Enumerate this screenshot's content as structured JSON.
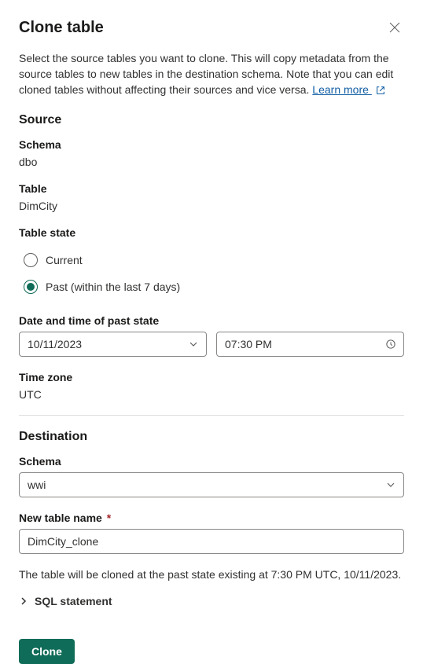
{
  "header": {
    "title": "Clone table"
  },
  "description": {
    "text": "Select the source tables you want to clone. This will copy metadata from the source tables to new tables in the destination schema. Note that you can edit cloned tables without affecting their sources and vice versa. ",
    "learn_more": "Learn more "
  },
  "source": {
    "heading": "Source",
    "schema_label": "Schema",
    "schema_value": "dbo",
    "table_label": "Table",
    "table_value": "DimCity",
    "state_label": "Table state",
    "radios": {
      "current": "Current",
      "past": "Past (within the last 7 days)"
    },
    "datetime_label": "Date and time of past state",
    "date_value": "10/11/2023",
    "time_value": "07:30 PM",
    "timezone_label": "Time zone",
    "timezone_value": "UTC"
  },
  "destination": {
    "heading": "Destination",
    "schema_label": "Schema",
    "schema_value": "wwi",
    "newname_label": "New table name",
    "newname_value": "DimCity_clone"
  },
  "summary": "The table will be cloned at the past state existing at 7:30 PM UTC, 10/11/2023.",
  "sql_toggle": "SQL statement",
  "actions": {
    "clone": "Clone"
  }
}
